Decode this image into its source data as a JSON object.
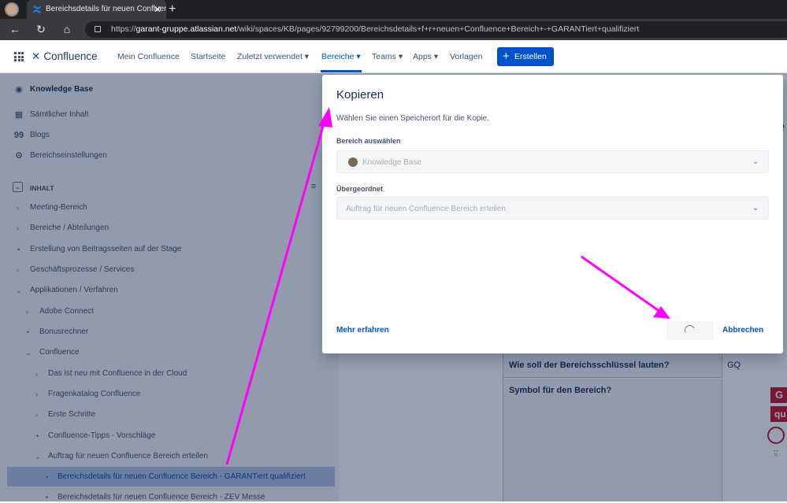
{
  "browser": {
    "tab_title": "Bereichsdetails für neuen Confluence",
    "url_prefix": "https://",
    "url_host": "garant-gruppe.atlassian.net",
    "url_path": "/wiki/spaces/KB/pages/92799200/Bereichsdetails+f+r+neuen+Confluence+Bereich+-+GARANTiert+qualifiziert"
  },
  "topnav": {
    "logo": "Confluence",
    "items": [
      "Mein Confluence",
      "Startseite",
      "Zuletzt verwendet ▾",
      "Bereiche ▾",
      "Teams ▾",
      "Apps ▾",
      "Vorlagen"
    ],
    "create": "Erstellen"
  },
  "sidebar": {
    "space_name": "Knowledge Base",
    "links": [
      "Sämtlicher Inhalt",
      "Blogs",
      "Bereichseinstellungen"
    ],
    "section": "INHALT",
    "tree": [
      "Meeting-Bereich",
      "Bereiche / Abteilungen",
      "Erstellung von Beitragsseiten auf der Stage",
      "Geschäftsprozesse / Services",
      "Applikationen / Verfahren",
      "Adobe Connect",
      "Bonusrechner",
      "Confluence",
      "Das ist neu mit Confluence in der Cloud",
      "Fragenkatalog Confluence",
      "Erste Schritte",
      "Confluence-Tipps - Vorschläge",
      "Auftrag für neuen Confluence Bereich erteilen",
      "Bereichsdetails für neuen Confluence Bereich - GARANTiert qualifiziert",
      "Bereichsdetails für neuen Confluence Bereich - ZEV Messe"
    ]
  },
  "page_table": {
    "q1": "Wie soll der Bereichsschlüssel lauten?",
    "a1": "GQ",
    "q2": "Symbol für den Bereich?",
    "logo_line1": "G",
    "logo_line2": "qu"
  },
  "modal": {
    "title": "Kopieren",
    "description": "Wählen Sie einen Speicherort für die Kopie.",
    "space_label": "Bereich auswählen",
    "space_value": "Knowledge Base",
    "parent_label": "Übergeordnet",
    "parent_value": "Auftrag für neuen Confluence Bereich erteilen",
    "learn_more": "Mehr erfahren",
    "cancel": "Abbrechen"
  },
  "colors": {
    "accent": "#0052cc",
    "annotation_arrow": "#ff00ff"
  }
}
